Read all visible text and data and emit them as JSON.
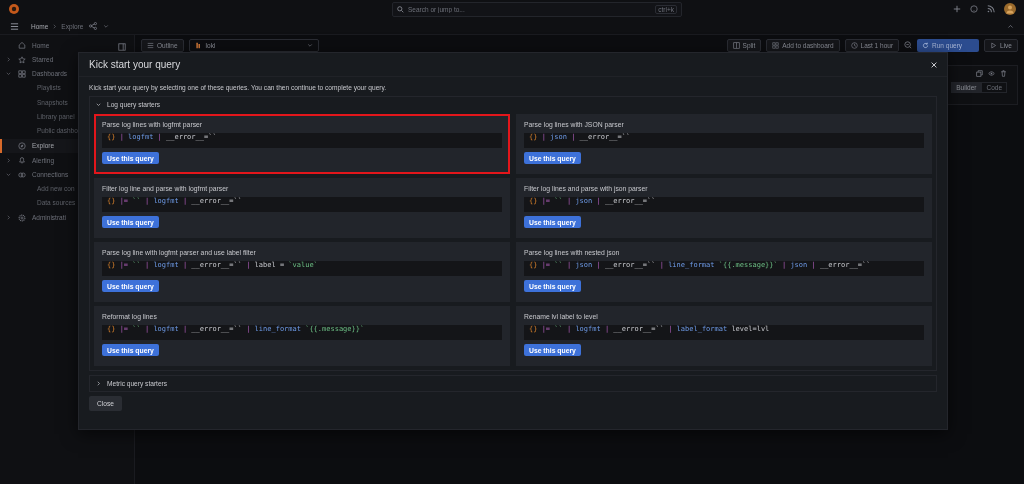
{
  "topbar": {
    "search": {
      "placeholder": "Search or jump to..."
    },
    "shortcut": "ctrl+k"
  },
  "breadcrumbs": [
    "Home",
    "Explore"
  ],
  "sidebar": {
    "items": [
      {
        "label": "Home",
        "selected": false
      },
      {
        "label": "Starred",
        "selected": false,
        "expanded": false
      },
      {
        "label": "Dashboards",
        "selected": false,
        "expanded": true,
        "children": [
          {
            "label": "Playlists"
          },
          {
            "label": "Snapshots"
          },
          {
            "label": "Library panel"
          },
          {
            "label": "Public dashbo"
          }
        ]
      },
      {
        "label": "Explore",
        "selected": true
      },
      {
        "label": "Alerting",
        "selected": false,
        "expanded": false
      },
      {
        "label": "Connections",
        "selected": false,
        "expanded": true,
        "children": [
          {
            "label": "Add new con"
          },
          {
            "label": "Data sources"
          }
        ]
      },
      {
        "label": "Administrati",
        "selected": false,
        "expanded": false
      }
    ]
  },
  "toolbar": {
    "outline": "Outline",
    "datasource": "loki",
    "split": "Split",
    "add": "Add to dashboard",
    "time_range": "Last 1 hour",
    "run": "Run query",
    "live": "Live"
  },
  "editor_modes": [
    {
      "label": "Builder",
      "selected": true
    },
    {
      "label": "Code",
      "selected": false
    }
  ],
  "modal": {
    "title": "Kick start your query",
    "description": "Kick start your query by selecting one of these queries. You can then continue to complete your query.",
    "sections": [
      {
        "title": "Log query starters",
        "expanded": true,
        "queries": [
          {
            "title": "Parse log lines with logfmt parser",
            "highlighted": true,
            "button": "Use this query",
            "tokens": [
              {
                "kind": "brace",
                "t": "{}"
              },
              {
                "kind": "op",
                "t": "|"
              },
              {
                "kind": "kw",
                "t": "logfmt"
              },
              {
                "kind": "op",
                "t": "|"
              },
              {
                "kind": "text",
                "t": "__error__=``"
              }
            ]
          },
          {
            "title": "Parse log lines with JSON parser",
            "highlighted": false,
            "button": "Use this query",
            "tokens": [
              {
                "kind": "brace",
                "t": "{}"
              },
              {
                "kind": "op",
                "t": "|"
              },
              {
                "kind": "kw",
                "t": "json"
              },
              {
                "kind": "op",
                "t": "|"
              },
              {
                "kind": "text",
                "t": "__error__=``"
              }
            ]
          },
          {
            "title": "Filter log line and parse with logfmt parser",
            "highlighted": false,
            "button": "Use this query",
            "tokens": [
              {
                "kind": "brace",
                "t": "{}"
              },
              {
                "kind": "op",
                "t": "|="
              },
              {
                "kind": "str",
                "t": "``"
              },
              {
                "kind": "op",
                "t": "|"
              },
              {
                "kind": "kw",
                "t": "logfmt"
              },
              {
                "kind": "op",
                "t": "|"
              },
              {
                "kind": "text",
                "t": "__error__=``"
              }
            ]
          },
          {
            "title": "Filter log lines and parse with json parser",
            "highlighted": false,
            "button": "Use this query",
            "tokens": [
              {
                "kind": "brace",
                "t": "{}"
              },
              {
                "kind": "op",
                "t": "|="
              },
              {
                "kind": "str",
                "t": "``"
              },
              {
                "kind": "op",
                "t": "|"
              },
              {
                "kind": "kw",
                "t": "json"
              },
              {
                "kind": "op",
                "t": "|"
              },
              {
                "kind": "text",
                "t": "__error__=``"
              }
            ]
          },
          {
            "title": "Parse log line with logfmt parser and use label filter",
            "highlighted": false,
            "button": "Use this query",
            "tokens": [
              {
                "kind": "brace",
                "t": "{}"
              },
              {
                "kind": "op",
                "t": "|="
              },
              {
                "kind": "str",
                "t": "``"
              },
              {
                "kind": "op",
                "t": "|"
              },
              {
                "kind": "kw",
                "t": "logfmt"
              },
              {
                "kind": "op",
                "t": "|"
              },
              {
                "kind": "text",
                "t": "__error__=``"
              },
              {
                "kind": "op",
                "t": "|"
              },
              {
                "kind": "text",
                "t": "label"
              },
              {
                "kind": "text",
                "t": "="
              },
              {
                "kind": "str",
                "t": "`value`"
              }
            ]
          },
          {
            "title": "Parse log lines with nested json",
            "highlighted": false,
            "button": "Use this query",
            "tokens": [
              {
                "kind": "brace",
                "t": "{}"
              },
              {
                "kind": "op",
                "t": "|="
              },
              {
                "kind": "str",
                "t": "``"
              },
              {
                "kind": "op",
                "t": "|"
              },
              {
                "kind": "kw",
                "t": "json"
              },
              {
                "kind": "op",
                "t": "|"
              },
              {
                "kind": "text",
                "t": "__error__=``"
              },
              {
                "kind": "op",
                "t": "|"
              },
              {
                "kind": "kw",
                "t": "line_format"
              },
              {
                "kind": "str",
                "t": "`{{.message}}`"
              },
              {
                "kind": "op",
                "t": "|"
              },
              {
                "kind": "kw",
                "t": "json"
              },
              {
                "kind": "op",
                "t": "|"
              },
              {
                "kind": "text",
                "t": "__error__=``"
              }
            ]
          },
          {
            "title": "Reformat log lines",
            "highlighted": false,
            "button": "Use this query",
            "tokens": [
              {
                "kind": "brace",
                "t": "{}"
              },
              {
                "kind": "op",
                "t": "|="
              },
              {
                "kind": "str",
                "t": "``"
              },
              {
                "kind": "op",
                "t": "|"
              },
              {
                "kind": "kw",
                "t": "logfmt"
              },
              {
                "kind": "op",
                "t": "|"
              },
              {
                "kind": "text",
                "t": "__error__=``"
              },
              {
                "kind": "op",
                "t": "|"
              },
              {
                "kind": "kw",
                "t": "line_format"
              },
              {
                "kind": "str",
                "t": "`{{.message}}`"
              }
            ]
          },
          {
            "title": "Rename lvl label to level",
            "highlighted": false,
            "button": "Use this query",
            "tokens": [
              {
                "kind": "brace",
                "t": "{}"
              },
              {
                "kind": "op",
                "t": "|="
              },
              {
                "kind": "str",
                "t": "``"
              },
              {
                "kind": "op",
                "t": "|"
              },
              {
                "kind": "kw",
                "t": "logfmt"
              },
              {
                "kind": "op",
                "t": "|"
              },
              {
                "kind": "text",
                "t": "__error__=``"
              },
              {
                "kind": "op",
                "t": "|"
              },
              {
                "kind": "kw",
                "t": "label_format"
              },
              {
                "kind": "text",
                "t": "level=lvl"
              }
            ]
          }
        ]
      },
      {
        "title": "Metric query starters",
        "expanded": false
      }
    ],
    "close_button": "Close"
  }
}
